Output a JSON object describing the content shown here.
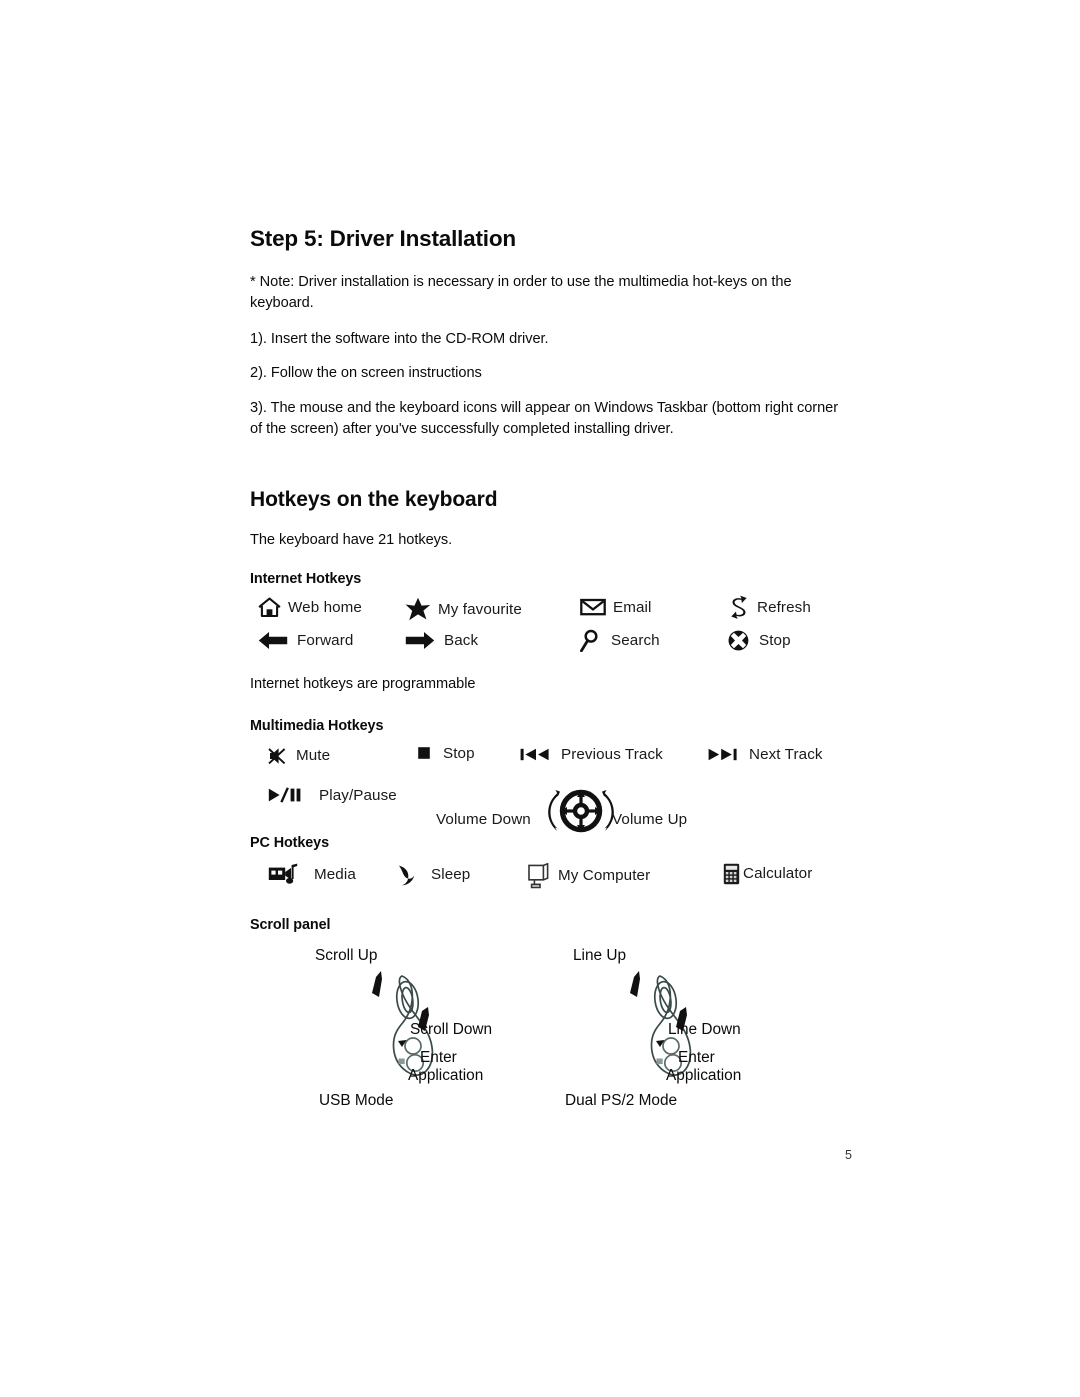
{
  "document": {
    "page_number": "5"
  },
  "step_section": {
    "heading": "Step 5: Driver Installation",
    "note": "* Note: Driver installation is necessary in order to use the multimedia hot-keys on the keyboard.",
    "steps": [
      "1). Insert the software into the CD-ROM driver.",
      "2). Follow the on screen instructions",
      "3). The mouse and the keyboard icons will appear on Windows Taskbar (bottom right corner of the screen) after you've successfully completed installing driver."
    ]
  },
  "hotkeys_section": {
    "heading": "Hotkeys on the keyboard",
    "intro": "The keyboard have 21 hotkeys.",
    "internet": {
      "heading": "Internet Hotkeys",
      "note": "Internet hotkeys are programmable",
      "items": [
        {
          "label": "Web home",
          "icon": "home-icon"
        },
        {
          "label": "My favourite",
          "icon": "star-icon"
        },
        {
          "label": "Email",
          "icon": "envelope-icon"
        },
        {
          "label": "Refresh",
          "icon": "refresh-icon"
        },
        {
          "label": "Forward",
          "icon": "arrow-left-icon"
        },
        {
          "label": "Back",
          "icon": "arrow-right-icon"
        },
        {
          "label": "Search",
          "icon": "magnifier-icon"
        },
        {
          "label": "Stop",
          "icon": "stop-circle-x-icon"
        }
      ]
    },
    "multimedia": {
      "heading": "Multimedia Hotkeys",
      "items": [
        {
          "label": "Mute",
          "icon": "mute-speaker-icon"
        },
        {
          "label": "Stop",
          "icon": "stop-square-icon"
        },
        {
          "label": "Previous Track",
          "icon": "previous-track-icon"
        },
        {
          "label": "Next Track",
          "icon": "next-track-icon"
        },
        {
          "label": "Play/Pause",
          "icon": "play-pause-icon"
        }
      ],
      "volume": {
        "down_label": "Volume Down",
        "up_label": "Volume Up",
        "icon": "volume-dial-icon"
      }
    },
    "pc": {
      "heading": "PC Hotkeys",
      "items": [
        {
          "label": "Media",
          "icon": "media-camera-icon"
        },
        {
          "label": "Sleep",
          "icon": "moon-icon"
        },
        {
          "label": "My Computer",
          "icon": "monitor-icon"
        },
        {
          "label": "Calculator",
          "icon": "calculator-icon"
        }
      ]
    },
    "scroll_panel": {
      "heading": "Scroll panel",
      "panels": [
        {
          "top_label": "Scroll Up",
          "side_label_1": "Scroll Down",
          "side_label_2": "Enter",
          "side_label_3": "Application",
          "bottom_label": "USB Mode"
        },
        {
          "top_label": "Line Up",
          "side_label_1": "Line Down",
          "side_label_2": "Enter",
          "side_label_3": "Application",
          "bottom_label": "Dual PS/2 Mode"
        }
      ]
    }
  }
}
